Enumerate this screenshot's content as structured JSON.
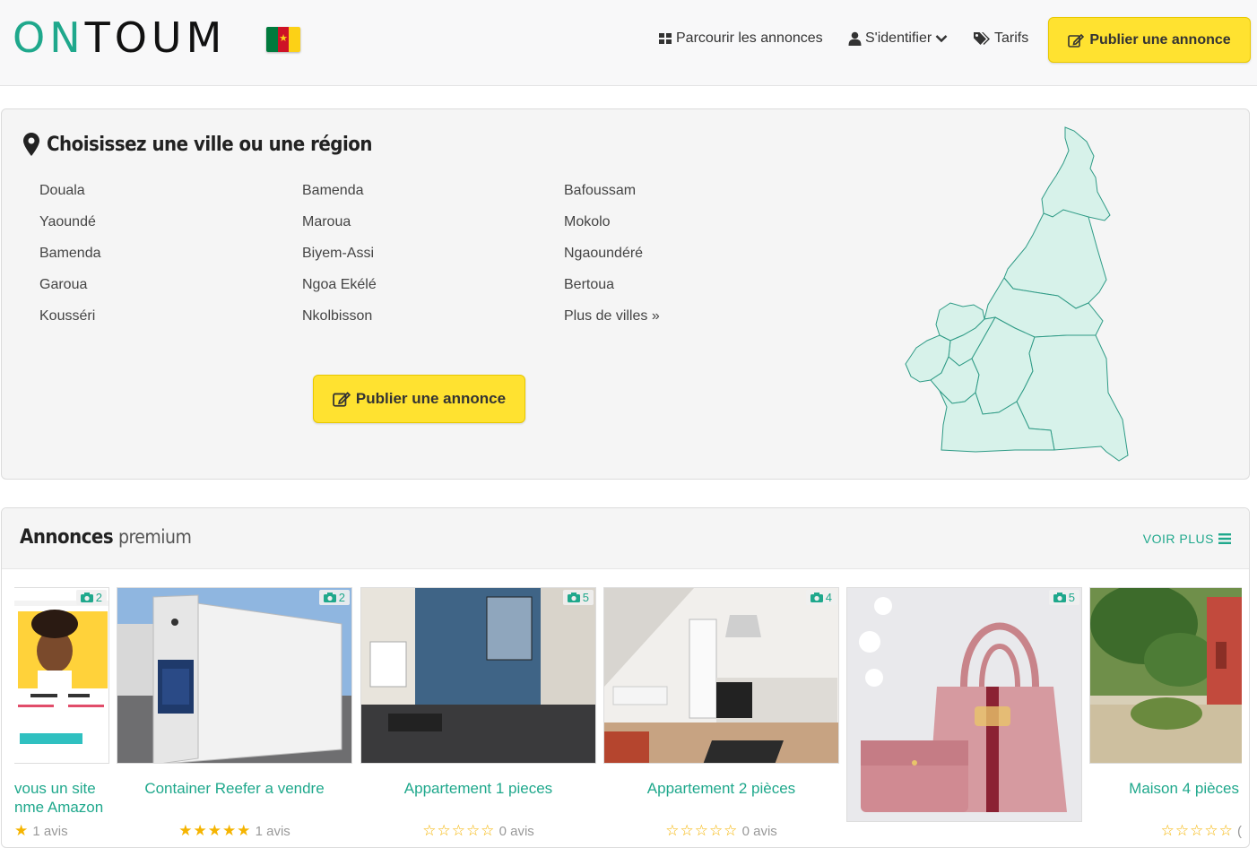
{
  "header": {
    "logo_on": "ON",
    "logo_toum": "TOUM",
    "nav_browse": "Parcourir les annonces",
    "nav_login": "S'identifier",
    "nav_tarifs": "Tarifs",
    "publish_button": "Publier une annonce"
  },
  "region": {
    "title": "Choisissez une ville ou une région",
    "col1": [
      "Douala",
      "Yaoundé",
      "Bamenda",
      "Garoua",
      "Kousséri"
    ],
    "col2": [
      "Bamenda",
      "Maroua",
      "Biyem-Assi",
      "Ngoa Ekélé",
      "Nkolbisson"
    ],
    "col3": [
      "Bafoussam",
      "Mokolo",
      "Ngaoundéré",
      "Bertoua",
      "Plus de villes »"
    ],
    "publish_button": "Publier une annonce"
  },
  "premium": {
    "title_bold": "Annonces",
    "title_light": "premium",
    "voir_plus": "VOIR PLUS",
    "cards": [
      {
        "photo_count": "2",
        "title_line1": "vous un site",
        "title_line2": "nme Amazon",
        "stars": "★",
        "reviews": "1 avis"
      },
      {
        "photo_count": "2",
        "title": "Container Reefer a vendre",
        "stars": "★★★★★",
        "reviews": "1 avis"
      },
      {
        "photo_count": "5",
        "title": "Appartement 1 pieces",
        "stars": "☆☆☆☆☆",
        "reviews": "0 avis"
      },
      {
        "photo_count": "4",
        "title": "Appartement 2 pièces",
        "stars": "☆☆☆☆☆",
        "reviews": "0 avis"
      },
      {
        "photo_count": "5",
        "title": "",
        "stars": "",
        "reviews": ""
      },
      {
        "photo_count": "",
        "title": "Maison 4 pièces",
        "stars": "☆☆☆☆☆",
        "reviews": "("
      }
    ]
  },
  "colors": {
    "accent": "#1fa88c",
    "button_yellow": "#ffe230",
    "map_fill": "#d7f2ea"
  }
}
